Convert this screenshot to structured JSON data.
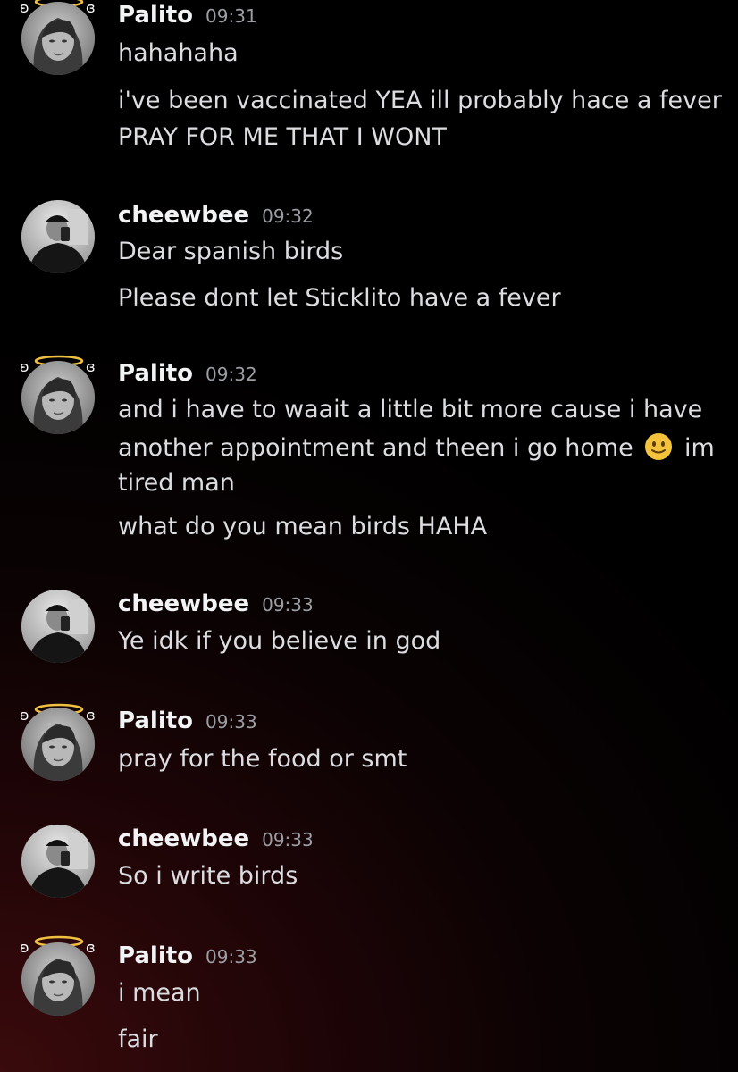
{
  "messages": [
    {
      "author": "Palito",
      "time": "09:31",
      "lines": [
        "hahahaha",
        "i've been vaccinated YEA ill probably hace a fever",
        "PRAY FOR ME THAT I WONT"
      ]
    },
    {
      "author": "cheewbee",
      "time": "09:32",
      "lines": [
        "Dear spanish birds",
        "Please dont let Sticklito have a fever"
      ]
    },
    {
      "author": "Palito",
      "time": "09:32",
      "lines": [
        "and i have to waait a little bit more cause i have",
        "another appointment and theen i go home",
        "im",
        "tired man",
        "what do you mean birds HAHA"
      ],
      "emoji": "slightly-smiling-face-emoji"
    },
    {
      "author": "cheewbee",
      "time": "09:33",
      "lines": [
        "Ye idk if you believe in god"
      ]
    },
    {
      "author": "Palito",
      "time": "09:33",
      "lines": [
        "pray for the food or smt"
      ]
    },
    {
      "author": "cheewbee",
      "time": "09:33",
      "lines": [
        "So i write birds"
      ]
    },
    {
      "author": "Palito",
      "time": "09:33",
      "lines": [
        "i mean",
        "fair"
      ]
    }
  ],
  "icons": {
    "halo": "angel-halo-icon",
    "wings": "wings-icon"
  },
  "colors": {
    "username": "#f2f3f5",
    "timestamp": "#9b9ea3",
    "text": "#dcdde0",
    "halo": "#f0c040"
  }
}
